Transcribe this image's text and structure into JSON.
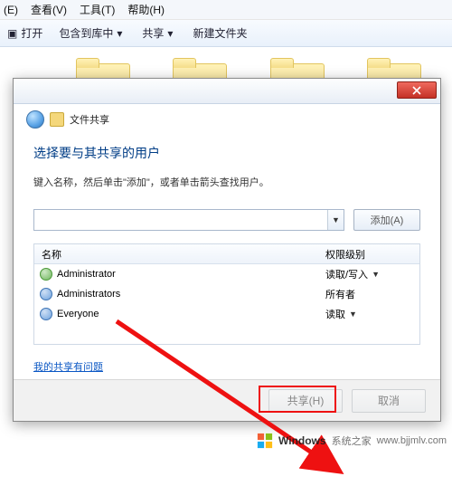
{
  "menubar": {
    "items": [
      "(E)",
      "查看(V)",
      "工具(T)",
      "帮助(H)"
    ]
  },
  "toolbar": {
    "open": "打开",
    "archive": "包含到库中",
    "share": "共享",
    "newFolder": "新建文件夹"
  },
  "dialog": {
    "crumb": "文件共享",
    "heading": "选择要与其共享的用户",
    "subtext": "键入名称，然后单击\"添加\"，或者单击箭头查找用户。",
    "input_value": "",
    "add_label": "添加(A)",
    "columns": {
      "name": "名称",
      "perm": "权限级别"
    },
    "rows": [
      {
        "name": "Administrator",
        "perm": "读取/写入",
        "caret": true,
        "grp": false
      },
      {
        "name": "Administrators",
        "perm": "所有者",
        "caret": false,
        "grp": true
      },
      {
        "name": "Everyone",
        "perm": "读取",
        "caret": true,
        "grp": true
      }
    ],
    "link": "我的共享有问题",
    "footer": {
      "primary": "共享(H)",
      "cancel": "取消"
    }
  },
  "watermark": {
    "brand": "Windows",
    "sub": "系统之家",
    "url": "www.bjjmlv.com"
  }
}
